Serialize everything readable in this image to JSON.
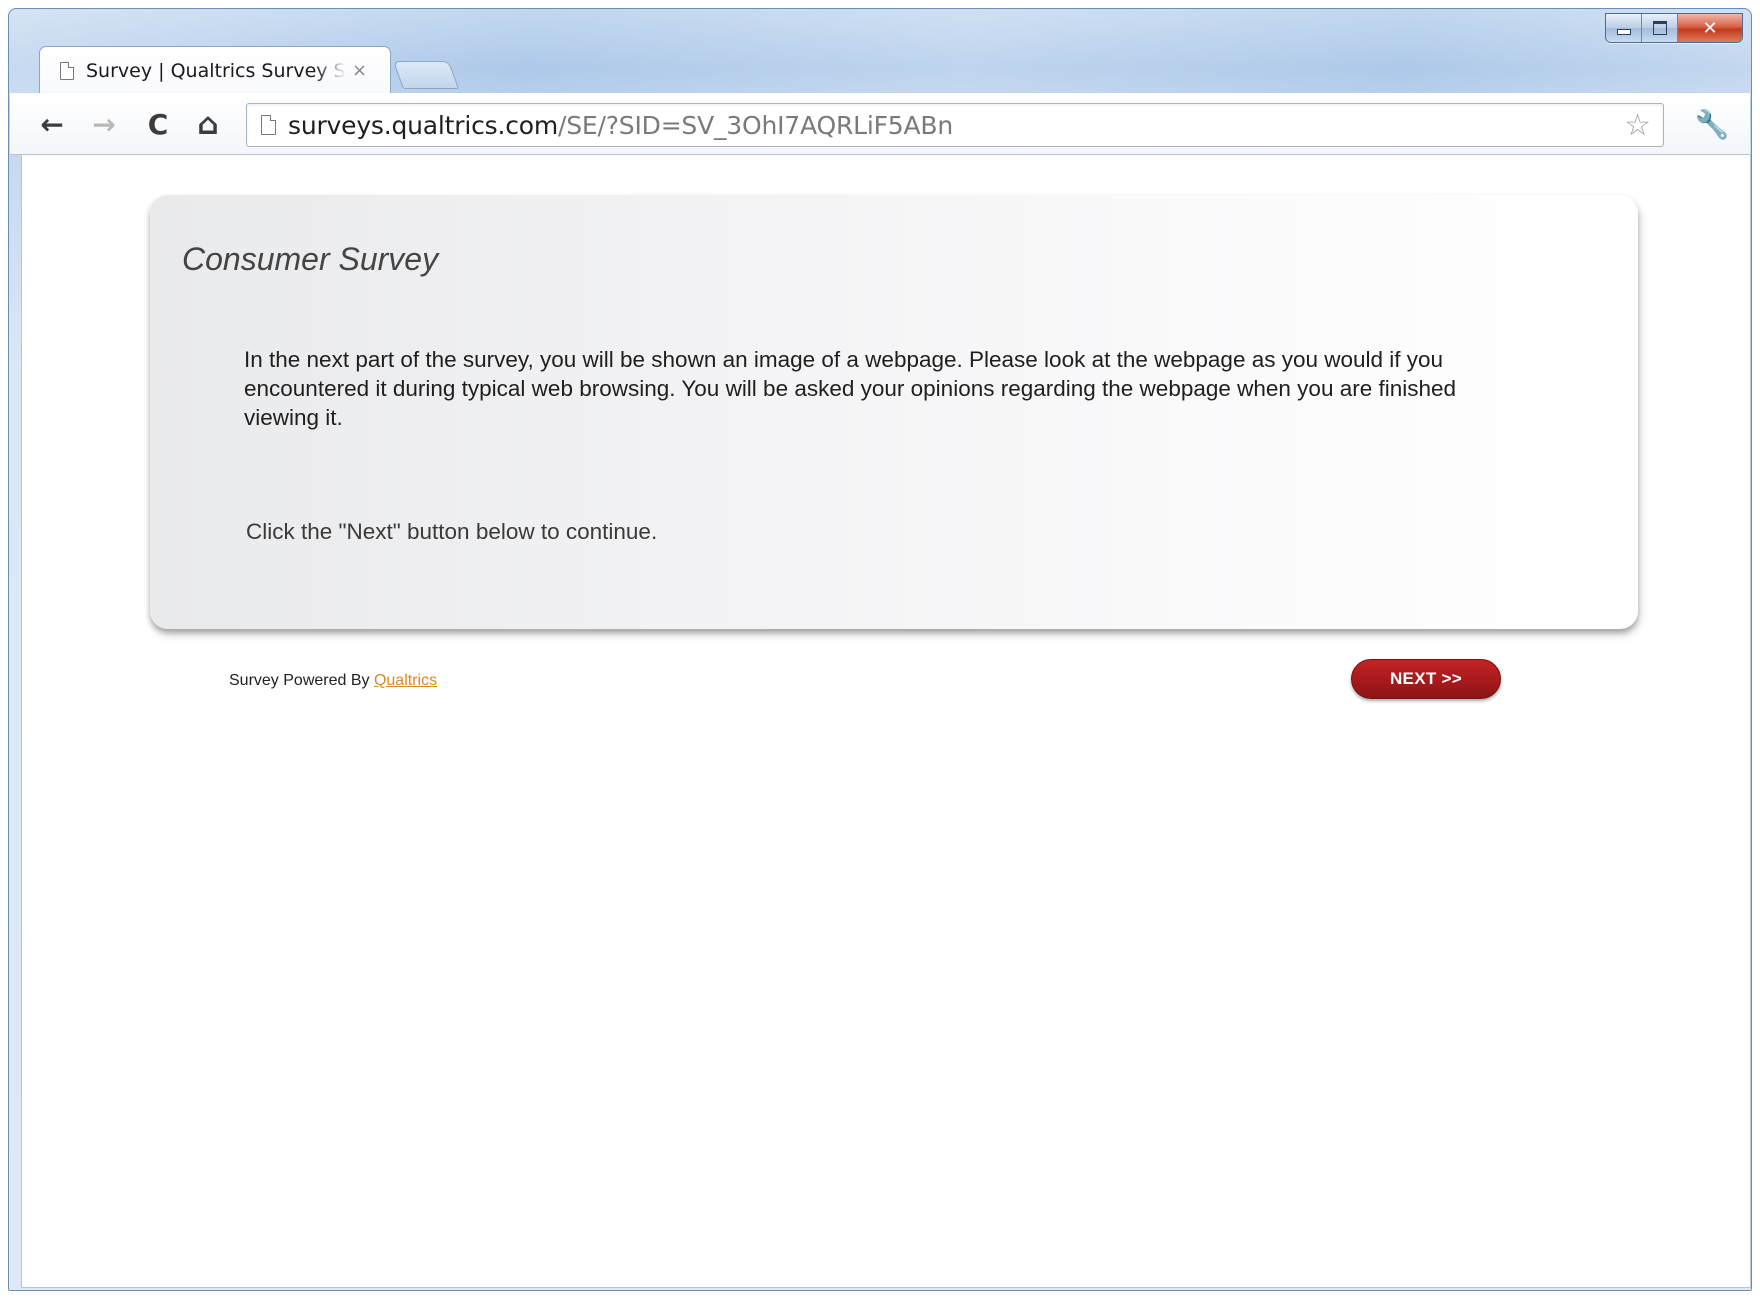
{
  "browser": {
    "tab": {
      "title": "Survey | Qualtrics Survey Software",
      "close_glyph": "×",
      "icon": "page-icon"
    },
    "window_controls": {
      "minimize": "minimize-icon",
      "maximize": "maximize-icon",
      "close_glyph": "✕"
    },
    "toolbar": {
      "back_glyph": "←",
      "forward_glyph": "→",
      "reload_glyph": "C",
      "home_glyph": "⌂",
      "star_glyph": "☆",
      "wrench_glyph": "🔧"
    },
    "address_bar": {
      "host": "surveys.qualtrics.com",
      "path": "/SE/?SID=SV_3OhI7AQRLiF5ABn"
    }
  },
  "survey": {
    "title": "Consumer Survey",
    "body": "In the next part of the survey, you will be shown an image of a webpage. Please look at the webpage as you would if you encountered it during typical web browsing. You will be asked your opinions regarding the webpage when you are finished viewing it.",
    "instruction": "Click the \"Next\" button below to continue."
  },
  "footer": {
    "powered_by": "Survey Powered By ",
    "powered_link": "Qualtrics",
    "next_label": "NEXT >>"
  },
  "colors": {
    "next_button": "#a71a1c",
    "link": "#d98b1f",
    "title_text": "#444444"
  }
}
